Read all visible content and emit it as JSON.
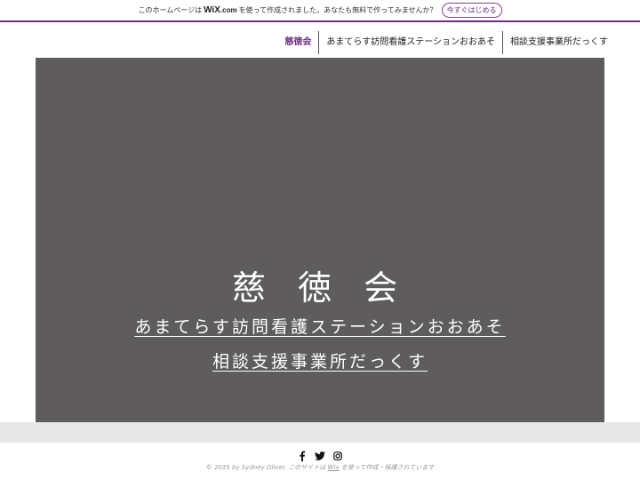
{
  "wix_banner": {
    "text_before": "このホームページは",
    "logo_main": "WiX",
    "logo_suffix": ".com",
    "text_after": "を使って作成されました。あなたも無料で作ってみませんか？",
    "cta_label": "今すぐはじめる"
  },
  "nav": {
    "items": [
      {
        "label": "慈徳会"
      },
      {
        "label": "あまてらす訪問看護ステーションおおあそ"
      },
      {
        "label": "相談支援事業所だっくす"
      }
    ]
  },
  "hero": {
    "title": "慈 徳 会",
    "link1": "あまてらす訪問看護ステーションおおあそ",
    "link2": "相談支援事業所だっくす"
  },
  "footer": {
    "social_icons": [
      "facebook-icon",
      "twitter-icon",
      "instagram-icon"
    ],
    "copyright_prefix": "© 2035 by Sydney Oliver. このサイトは",
    "copyright_wix": "Wix",
    "copyright_suffix": "を使って作成・保護されています"
  },
  "colors": {
    "accent": "#6b2f7f",
    "hero_bg": "#5e5c5c",
    "band_bg": "#e9e8e8"
  }
}
